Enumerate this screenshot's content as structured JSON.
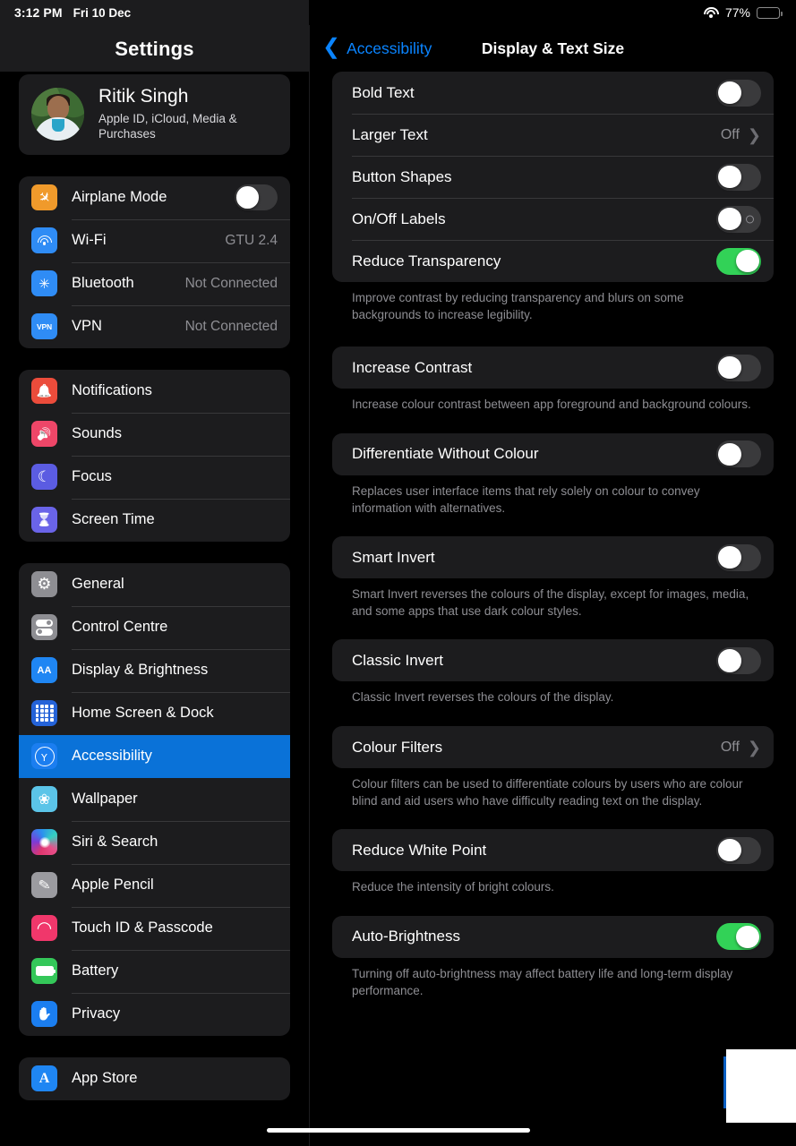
{
  "status_bar": {
    "time": "3:12 PM",
    "date": "Fri 10 Dec",
    "wifi_icon": "wifi-icon",
    "battery_percent": "77%",
    "battery_level": 77
  },
  "sidebar": {
    "title": "Settings",
    "profile": {
      "name": "Ritik Singh",
      "subtitle": "Apple ID, iCloud, Media & Purchases",
      "avatar_icon": "avatar"
    },
    "groups": [
      {
        "items": [
          {
            "label": "Airplane Mode",
            "icon": "airplane-icon",
            "value": "",
            "control": "toggle",
            "on": false
          },
          {
            "label": "Wi-Fi",
            "icon": "wifi-icon",
            "value": "GTU 2.4",
            "control": "value"
          },
          {
            "label": "Bluetooth",
            "icon": "bluetooth-icon",
            "value": "Not Connected",
            "control": "value"
          },
          {
            "label": "VPN",
            "icon": "vpn-icon",
            "value": "Not Connected",
            "control": "value"
          }
        ]
      },
      {
        "items": [
          {
            "label": "Notifications",
            "icon": "bell-icon",
            "value": "",
            "control": "none"
          },
          {
            "label": "Sounds",
            "icon": "speaker-icon",
            "value": "",
            "control": "none"
          },
          {
            "label": "Focus",
            "icon": "moon-icon",
            "value": "",
            "control": "none"
          },
          {
            "label": "Screen Time",
            "icon": "hourglass-icon",
            "value": "",
            "control": "none"
          }
        ]
      },
      {
        "items": [
          {
            "label": "General",
            "icon": "gear-icon",
            "value": "",
            "control": "none"
          },
          {
            "label": "Control Centre",
            "icon": "toggles-icon",
            "value": "",
            "control": "none"
          },
          {
            "label": "Display & Brightness",
            "icon": "aa-icon",
            "value": "",
            "control": "none"
          },
          {
            "label": "Home Screen & Dock",
            "icon": "grid-icon",
            "value": "",
            "control": "none"
          },
          {
            "label": "Accessibility",
            "icon": "accessibility-icon",
            "value": "",
            "control": "none",
            "selected": true
          },
          {
            "label": "Wallpaper",
            "icon": "flower-icon",
            "value": "",
            "control": "none"
          },
          {
            "label": "Siri & Search",
            "icon": "siri-icon",
            "value": "",
            "control": "none"
          },
          {
            "label": "Apple Pencil",
            "icon": "pencil-icon",
            "value": "",
            "control": "none"
          },
          {
            "label": "Touch ID & Passcode",
            "icon": "fingerprint-icon",
            "value": "",
            "control": "none"
          },
          {
            "label": "Battery",
            "icon": "battery-icon",
            "value": "",
            "control": "none"
          },
          {
            "label": "Privacy",
            "icon": "hand-icon",
            "value": "",
            "control": "none"
          }
        ]
      },
      {
        "items": [
          {
            "label": "App Store",
            "icon": "appstore-icon",
            "value": "",
            "control": "none"
          }
        ]
      }
    ],
    "selected_accent": "#0a72d8"
  },
  "detail": {
    "back_label": "Accessibility",
    "back_icon": "chevron-left-icon",
    "title": "Display & Text Size",
    "sections": [
      {
        "rows": [
          {
            "label": "Bold Text",
            "control": "toggle",
            "on": false
          },
          {
            "label": "Larger Text",
            "control": "disclosure",
            "value": "Off"
          },
          {
            "label": "Button Shapes",
            "control": "toggle",
            "on": false
          },
          {
            "label": "On/Off Labels",
            "control": "toggle",
            "on": false,
            "off_label_mark": true
          },
          {
            "label": "Reduce Transparency",
            "control": "toggle",
            "on": true
          }
        ],
        "footnote": "Improve contrast by reducing transparency and blurs on some backgrounds to increase legibility."
      },
      {
        "rows": [
          {
            "label": "Increase Contrast",
            "control": "toggle",
            "on": false
          }
        ],
        "footnote": "Increase colour contrast between app foreground and background colours."
      },
      {
        "rows": [
          {
            "label": "Differentiate Without Colour",
            "control": "toggle",
            "on": false
          }
        ],
        "footnote": "Replaces user interface items that rely solely on colour to convey information with alternatives."
      },
      {
        "rows": [
          {
            "label": "Smart Invert",
            "control": "toggle",
            "on": false
          }
        ],
        "footnote": "Smart Invert reverses the colours of the display, except for images, media, and some apps that use dark colour styles."
      },
      {
        "rows": [
          {
            "label": "Classic Invert",
            "control": "toggle",
            "on": false
          }
        ],
        "footnote": "Classic Invert reverses the colours of the display."
      },
      {
        "rows": [
          {
            "label": "Colour Filters",
            "control": "disclosure",
            "value": "Off"
          }
        ],
        "footnote": "Colour filters can be used to differentiate colours by users who are colour blind and aid users who have difficulty reading text on the display."
      },
      {
        "rows": [
          {
            "label": "Reduce White Point",
            "control": "toggle",
            "on": false
          }
        ],
        "footnote": "Reduce the intensity of bright colours."
      },
      {
        "rows": [
          {
            "label": "Auto-Brightness",
            "control": "toggle",
            "on": true
          }
        ],
        "footnote": "Turning off auto-brightness may affect battery life and long-term display performance."
      }
    ],
    "accent_link": "#0a84ff",
    "toggle_on_color": "#32d257"
  },
  "overlays": {
    "white_box": "white-overlay-box",
    "home_indicator": "home-indicator"
  }
}
